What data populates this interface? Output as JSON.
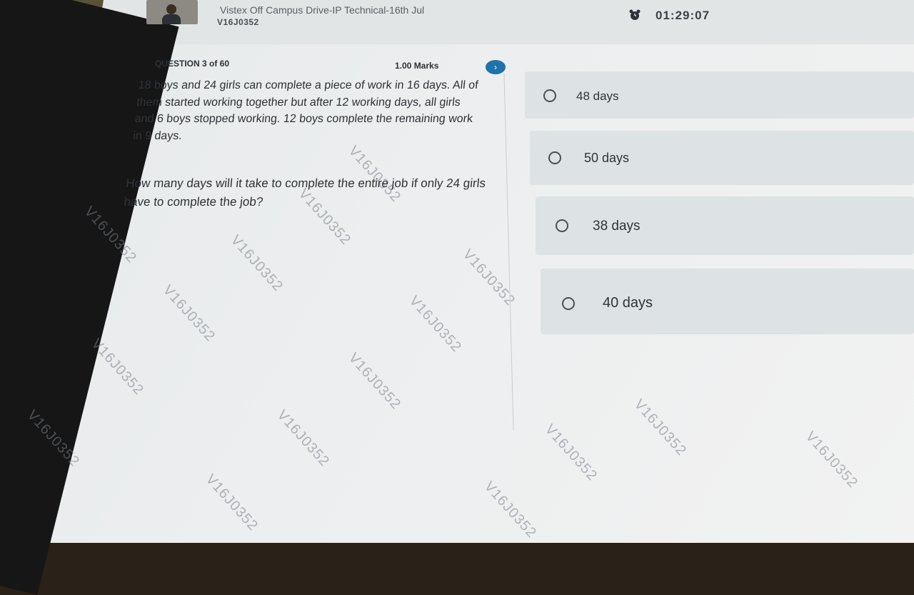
{
  "header": {
    "drive_title": "Vistex Off Campus Drive-IP Technical-16th Jul",
    "candidate_id": "V16J0352",
    "timer": "01:29:07",
    "alarm_icon": "alarm-clock-icon"
  },
  "question": {
    "number_label": "QUESTION 3 of 60",
    "marks": "1.00 Marks",
    "next_icon": "chevron-right-icon",
    "text": "18 boys and 24 girls can complete a piece of work in 16 days. All of them started working together but after 12 working days, all girls and 6 boys stopped working. 12 boys complete the remaining work in 9 days.",
    "ask": "How many days will it take to complete the entire job if only 24 girls have to complete the job?"
  },
  "options": [
    {
      "label": "48 days"
    },
    {
      "label": "50 days"
    },
    {
      "label": "38 days"
    },
    {
      "label": "40 days"
    }
  ],
  "watermark": "V16J0352",
  "colors": {
    "accent": "#1f73a8",
    "option_bg": "#dde3e4"
  }
}
